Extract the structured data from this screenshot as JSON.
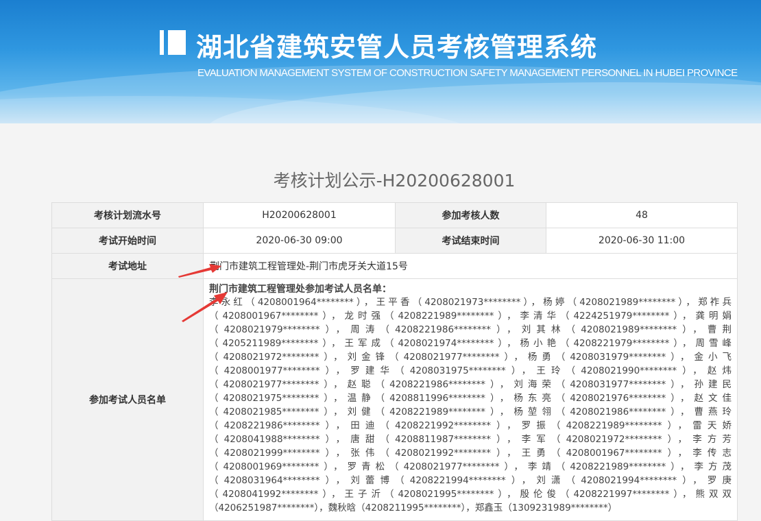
{
  "header": {
    "title_cn": "湖北省建筑安管人员考核管理系统",
    "title_en": "EVALUATION MANAGEMENT SYSTEM OF CONSTRUCTION SAFETY MANAGEMENT PERSONNEL IN HUBEI PROVINCE"
  },
  "page": {
    "heading": "考核计划公示-H20200628001"
  },
  "table": {
    "plan_no_label": "考核计划流水号",
    "plan_no": "H20200628001",
    "count_label": "参加考核人数",
    "count": "48",
    "start_label": "考试开始时间",
    "start": "2020-06-30 09:00",
    "end_label": "考试结束时间",
    "end": "2020-06-30 11:00",
    "address_label": "考试地址",
    "address": "荆门市建筑工程管理处-荆门市虎牙关大道15号",
    "names_label": "参加考试人员名单",
    "names_title": "荆门市建筑工程管理处参加考试人员名单：",
    "names_text": "李永红（4208001964********），王平香（4208021973********），杨婷（4208021989********），郑祚兵（4208001967********），龙时强（4208221989********），李清华（4224251979********），龚明娟（4208021979********），周涛（4208221986********），刘其林（4208021989********），曹荆（4205211989********），王军成（4208021974********），杨小艳（4208221979********），周雪峰（4208021972********），刘金锋（4208021977********），杨勇（4208031979********），金小飞（4208001977********），罗建华（4208031975********），王玲（4208021990********），赵炜（4208021977********），赵聪（4208221986********），刘海荣（4208031977********），孙建民（4208021975********），温静（4208811996********），杨东亮（4208021976********），赵文佳（4208021985********），刘健（4208221989********），杨堃翎（4208021986********），曹燕玲（4208221986********），田迪（4208221992********），罗振（4208221989********），雷天娇（4208041988********），唐甜（4208811987********），李军（4208021972********），李方芳（4208021999********），张伟（4208021992********），王勇（4208001967********），李传志（4208001969********），罗青松（4208021977********），李靖（4208221989********），李方茂（4208031964********），刘蕾博（4208221994********），刘潇（4208021994********），罗庚（4208041992********），王子沂（4208021995********），殷伦俊（4208221997********），熊双双（4206251987********），魏秋晗（4208211995********），郑鑫玉（1309231989********）"
  },
  "annotations": {
    "arrow_color": "#e53935"
  }
}
